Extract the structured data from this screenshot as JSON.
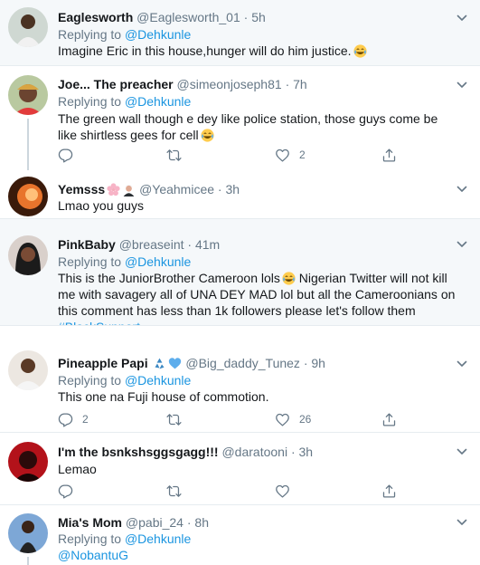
{
  "colors": {
    "link": "#1b95e0",
    "muted": "#657786",
    "text": "#14171a",
    "highlight_bg": "#f5f8fa",
    "divider": "#e6ecf0"
  },
  "tweets": [
    {
      "name": "Eaglesworth",
      "handle": "@Eaglesworth_01",
      "dot": "·",
      "time": "5h",
      "reply_prefix": "Replying to",
      "reply_handle": "@Dehkunle",
      "text": "Imagine Eric in this house,hunger will do him justice.",
      "text_emoji": "face-with-tears-of-joy-emoji"
    },
    {
      "name": "Joe... The preacher",
      "handle": "@simeonjoseph81",
      "dot": "·",
      "time": "7h",
      "reply_prefix": "Replying to",
      "reply_handle": "@Dehkunle",
      "text": "The green wall though e dey like police station, those guys come be like shirtless gees for cell",
      "text_emoji": "face-with-tears-of-joy-emoji",
      "actions": {
        "reply": "",
        "retweet": "",
        "like": "2"
      }
    },
    {
      "name": "Yemsss",
      "name_emojis": [
        "cherry-blossom-emoji",
        "man-judge-emoji"
      ],
      "handle": "@Yeahmicee",
      "dot": "·",
      "time": "3h",
      "text": "Lmao you guys"
    },
    {
      "name": "PinkBaby",
      "handle": "@breaseint",
      "dot": "·",
      "time": "41m",
      "reply_prefix": "Replying to",
      "reply_handle": "@Dehkunle",
      "text_part1": "This is the JuniorBrother Cameroon lols",
      "text_part2": "Nigerian Twitter will not kill me with savagery all of UNA DEY MAD lol but all the Cameroonians on this comment has less than 1k followers please let's follow them",
      "hashtag": "#BlackSupport",
      "text_emoji": "face-with-tears-of-joy-emoji"
    },
    {
      "name": "Pineapple Papi",
      "name_emojis": [
        "recycling-symbol-emoji",
        "blue-heart-emoji"
      ],
      "handle": "@Big_daddy_Tunez",
      "dot": "·",
      "time": "9h",
      "reply_prefix": "Replying to",
      "reply_handle": "@Dehkunle",
      "text": "This one na Fuji house of commotion.",
      "actions": {
        "reply": "2",
        "retweet": "",
        "like": "26"
      }
    },
    {
      "name": "I'm the bsnkshsggsgagg!!!",
      "handle": "@daratooni",
      "dot": "·",
      "time": "3h",
      "text": "Lemao",
      "actions": {
        "reply": "",
        "retweet": "",
        "like": ""
      }
    },
    {
      "name": "Mia's Mom",
      "handle": "@pabi_24",
      "dot": "·",
      "time": "8h",
      "reply_prefix": "Replying to",
      "reply_handle": "@Dehkunle",
      "mention": "@NobantuG"
    }
  ]
}
